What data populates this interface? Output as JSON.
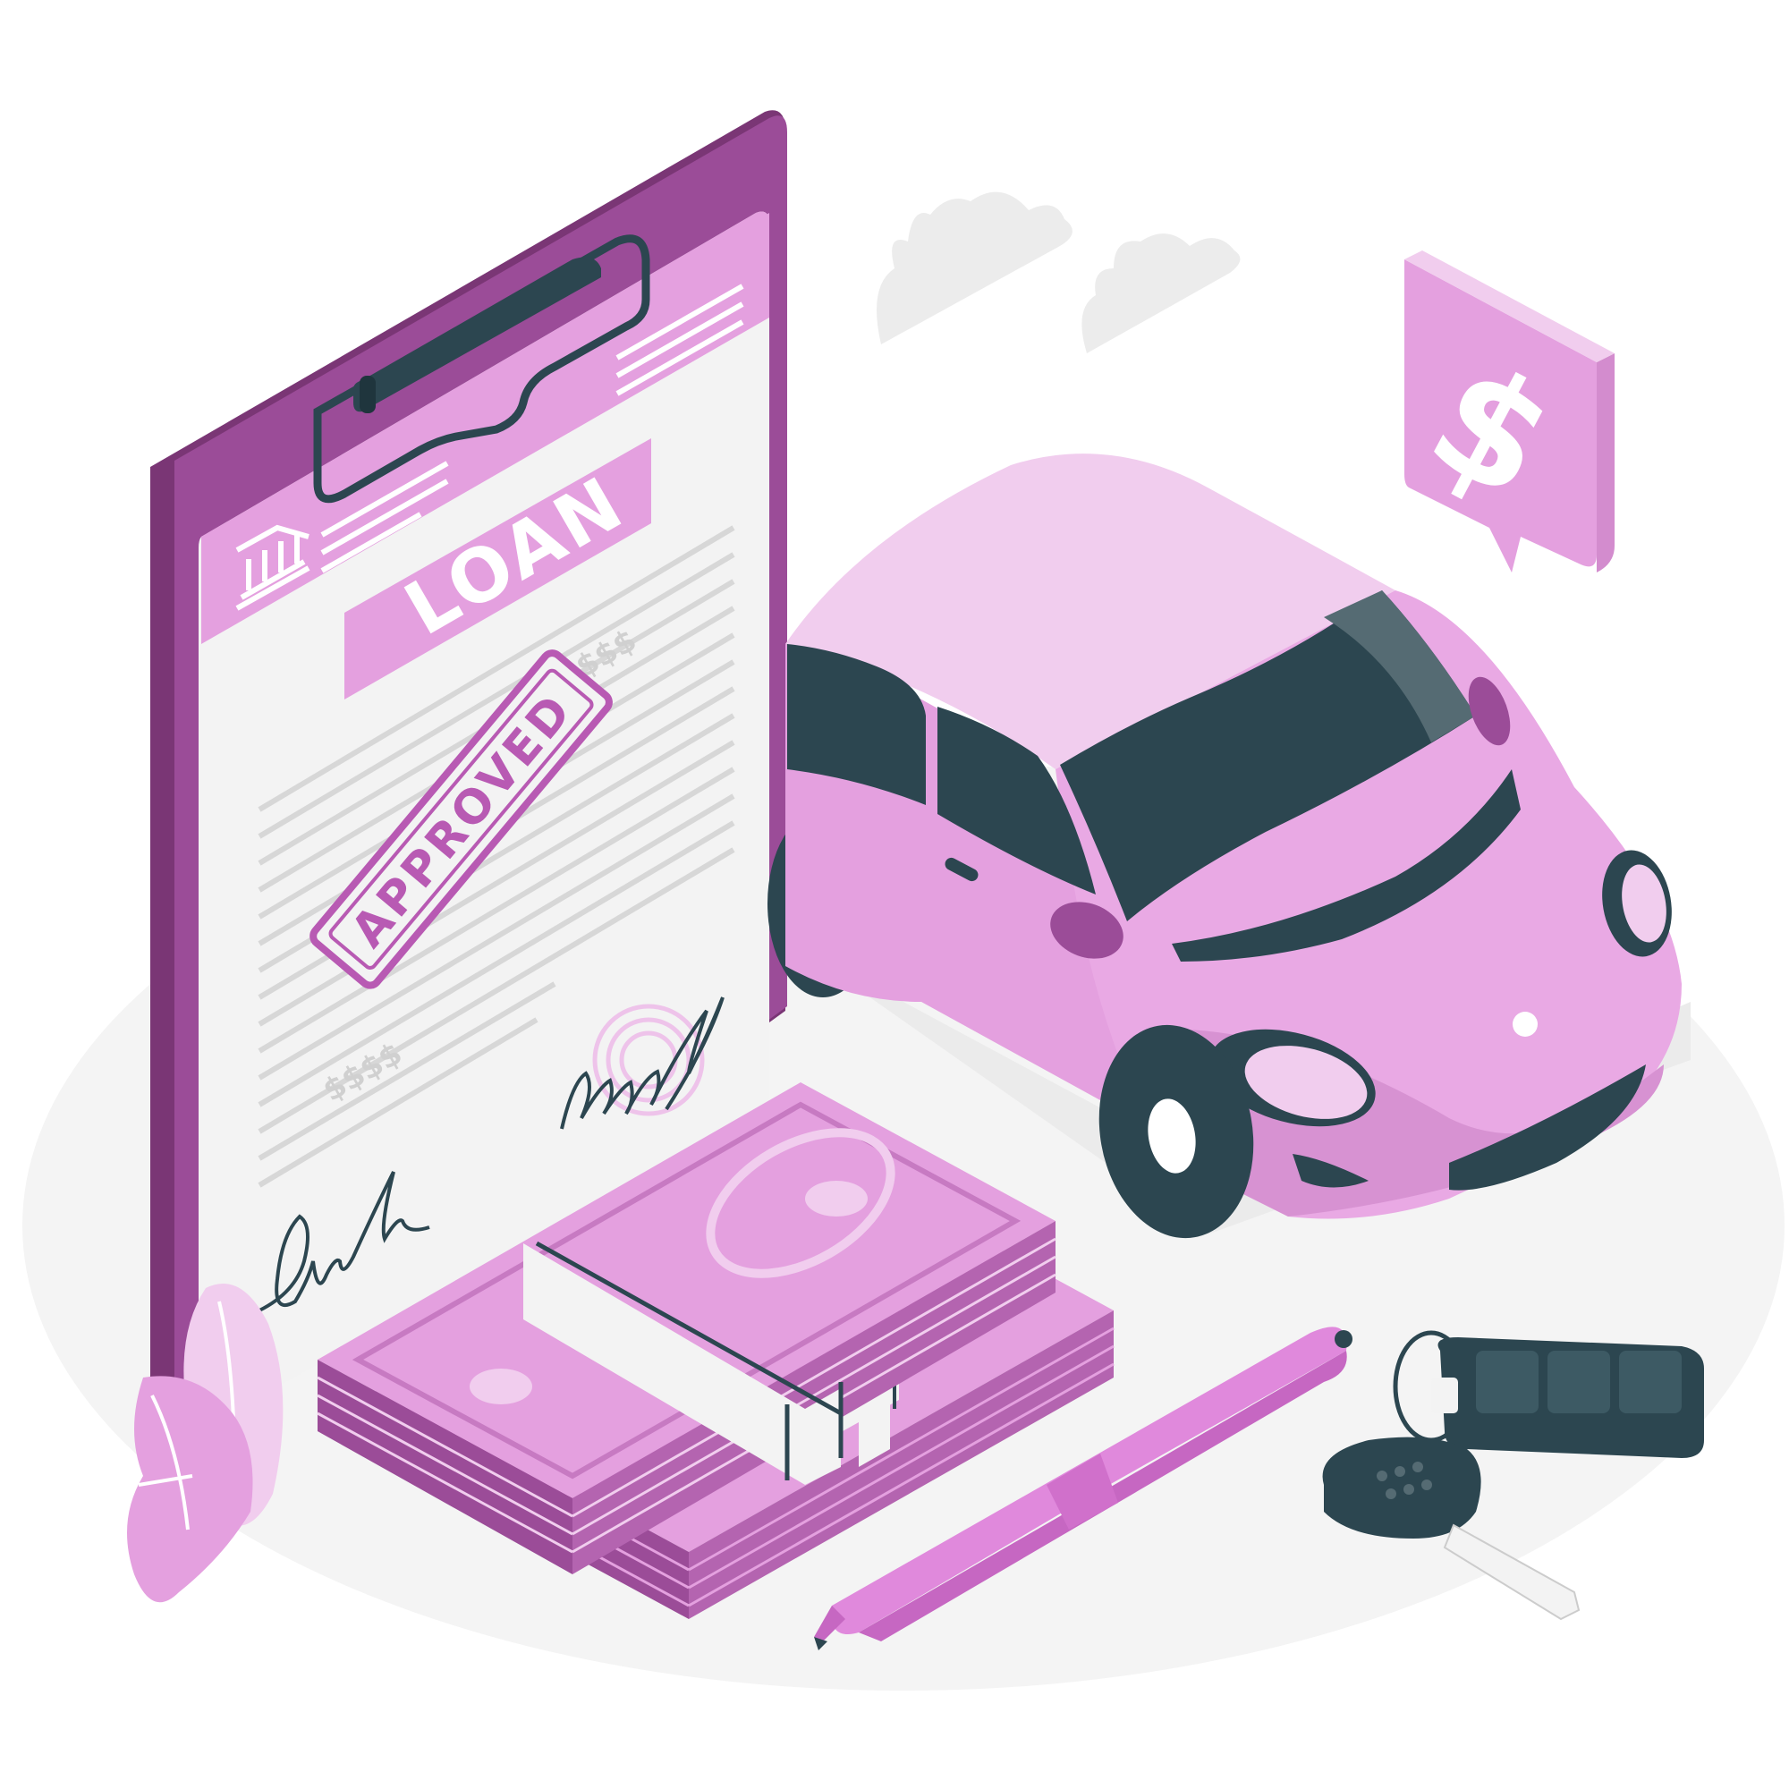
{
  "scene": {
    "subject": "car loan approval illustration"
  },
  "document": {
    "title": "LOAN",
    "stamp": "APPROVED",
    "money_marks": [
      "$$$$",
      "$$$$"
    ]
  },
  "price_badge": {
    "symbol": "$"
  },
  "colors": {
    "primary": "#e4a0df",
    "primary_dark": "#9b4c98",
    "primary_light": "#f1cdee",
    "dark": "#2c4650",
    "paper": "#f3f3f3",
    "ground": "#f4f4f4"
  }
}
